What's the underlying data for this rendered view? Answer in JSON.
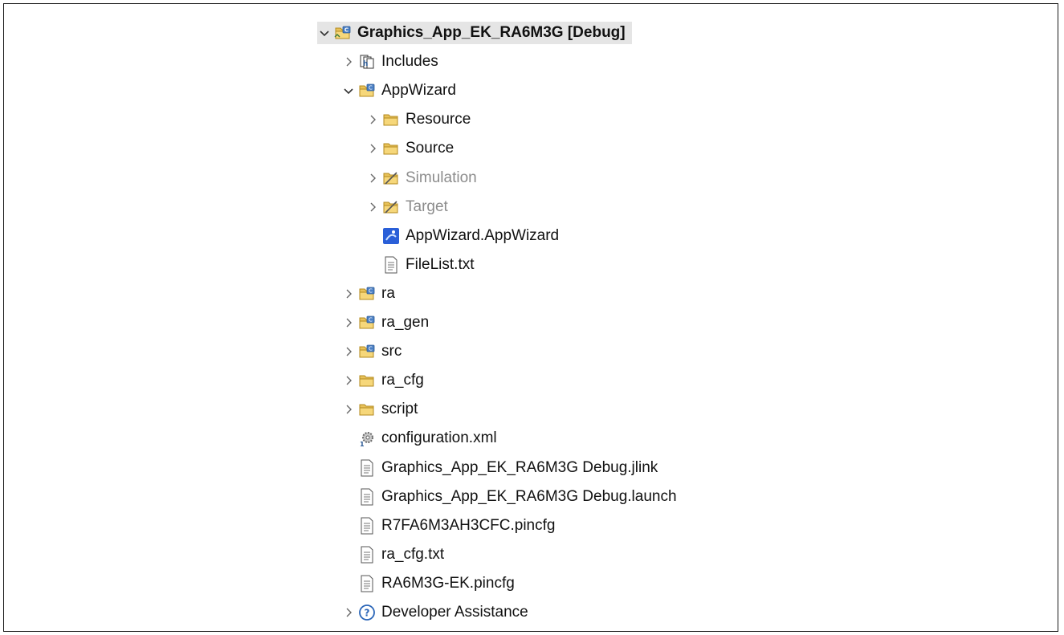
{
  "tree": [
    {
      "label": "Graphics_App_EK_RA6M3G [Debug]",
      "depth": 0,
      "expander": "expanded",
      "icon": "c-project-icon",
      "root": true
    },
    {
      "label": "Includes",
      "depth": 1,
      "expander": "collapsed",
      "icon": "includes-icon"
    },
    {
      "label": "AppWizard",
      "depth": 1,
      "expander": "expanded",
      "icon": "source-folder-icon"
    },
    {
      "label": "Resource",
      "depth": 2,
      "expander": "collapsed",
      "icon": "folder-icon"
    },
    {
      "label": "Source",
      "depth": 2,
      "expander": "collapsed",
      "icon": "folder-icon"
    },
    {
      "label": "Simulation",
      "depth": 2,
      "expander": "collapsed",
      "icon": "excluded-folder-icon",
      "muted": true
    },
    {
      "label": "Target",
      "depth": 2,
      "expander": "collapsed",
      "icon": "excluded-folder-icon",
      "muted": true
    },
    {
      "label": "AppWizard.AppWizard",
      "depth": 2,
      "expander": "none",
      "icon": "appwizard-file-icon"
    },
    {
      "label": "FileList.txt",
      "depth": 2,
      "expander": "none",
      "icon": "text-file-icon"
    },
    {
      "label": "ra",
      "depth": 1,
      "expander": "collapsed",
      "icon": "source-folder-icon"
    },
    {
      "label": "ra_gen",
      "depth": 1,
      "expander": "collapsed",
      "icon": "source-folder-icon"
    },
    {
      "label": "src",
      "depth": 1,
      "expander": "collapsed",
      "icon": "source-folder-icon"
    },
    {
      "label": "ra_cfg",
      "depth": 1,
      "expander": "collapsed",
      "icon": "folder-icon"
    },
    {
      "label": "script",
      "depth": 1,
      "expander": "collapsed",
      "icon": "folder-icon"
    },
    {
      "label": "configuration.xml",
      "depth": 1,
      "expander": "none",
      "icon": "configuration-icon"
    },
    {
      "label": "Graphics_App_EK_RA6M3G Debug.jlink",
      "depth": 1,
      "expander": "none",
      "icon": "text-file-icon"
    },
    {
      "label": "Graphics_App_EK_RA6M3G Debug.launch",
      "depth": 1,
      "expander": "none",
      "icon": "text-file-icon"
    },
    {
      "label": "R7FA6M3AH3CFC.pincfg",
      "depth": 1,
      "expander": "none",
      "icon": "text-file-icon"
    },
    {
      "label": "ra_cfg.txt",
      "depth": 1,
      "expander": "none",
      "icon": "text-file-icon"
    },
    {
      "label": "RA6M3G-EK.pincfg",
      "depth": 1,
      "expander": "none",
      "icon": "text-file-icon"
    },
    {
      "label": "Developer Assistance",
      "depth": 1,
      "expander": "collapsed",
      "icon": "help-icon"
    }
  ],
  "colors": {
    "folder": "#e8c25a",
    "folder_outline": "#b38a1e",
    "source_badge": "#4a7fc4",
    "root_highlight": "#e5e5e5",
    "muted_text": "#8c8c8c"
  }
}
